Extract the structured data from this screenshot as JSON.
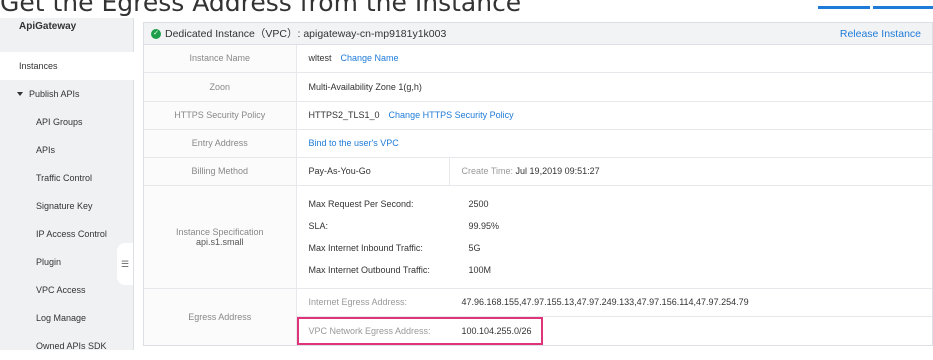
{
  "page": {
    "title": "Get the Egress Address from the Instance"
  },
  "sidebar": {
    "header": "ApiGateway",
    "items": [
      {
        "label": "Instances"
      },
      {
        "label": "Publish APIs"
      },
      {
        "label": "API Groups"
      },
      {
        "label": "APIs"
      },
      {
        "label": "Traffic Control"
      },
      {
        "label": "Signature Key"
      },
      {
        "label": "IP Access Control"
      },
      {
        "label": "Plugin"
      },
      {
        "label": "VPC Access"
      },
      {
        "label": "Log Manage"
      },
      {
        "label": "Owned APIs SDK"
      }
    ],
    "collapse_glyph": "☰"
  },
  "panel": {
    "header": "Dedicated Instance（VPC）:  apigateway-cn-mp9181y1k003",
    "release": "Release Instance",
    "rows": {
      "name": {
        "label": "Instance Name",
        "value": "wltest",
        "link": "Change Name"
      },
      "zone": {
        "label": "Zoon",
        "value": "Multi-Availability Zone 1(g,h)"
      },
      "https": {
        "label": "HTTPS Security Policy",
        "value": "HTTPS2_TLS1_0",
        "link": "Change HTTPS Security Policy"
      },
      "entry": {
        "label": "Entry Address",
        "link": "Bind to the user's VPC"
      },
      "billing": {
        "label": "Billing Method",
        "value": "Pay-As-You-Go",
        "create_label": "Create Time:",
        "create_value": "Jul 19,2019 09:51:27"
      },
      "spec": {
        "label": "Instance Specification",
        "sublabel": "api.s1.small",
        "items": [
          {
            "k": "Max Request Per Second:",
            "v": "2500"
          },
          {
            "k": "SLA:",
            "v": "99.95%"
          },
          {
            "k": "Max Internet Inbound Traffic:",
            "v": "5G"
          },
          {
            "k": "Max Internet Outbound Traffic:",
            "v": "100M"
          }
        ]
      },
      "egress": {
        "label": "Egress Address",
        "internet_label": "Internet Egress Address:",
        "internet_value": "47.96.168.155,47.97.155.13,47.97.249.133,47.97.156.114,47.97.254.79",
        "vpc_label": "VPC Network Egress Address:",
        "vpc_value": "100.104.255.0/26"
      }
    }
  },
  "colors": {
    "accent": "#1f7bd8",
    "highlight": "#e0347a",
    "success": "#1e9e4a"
  }
}
